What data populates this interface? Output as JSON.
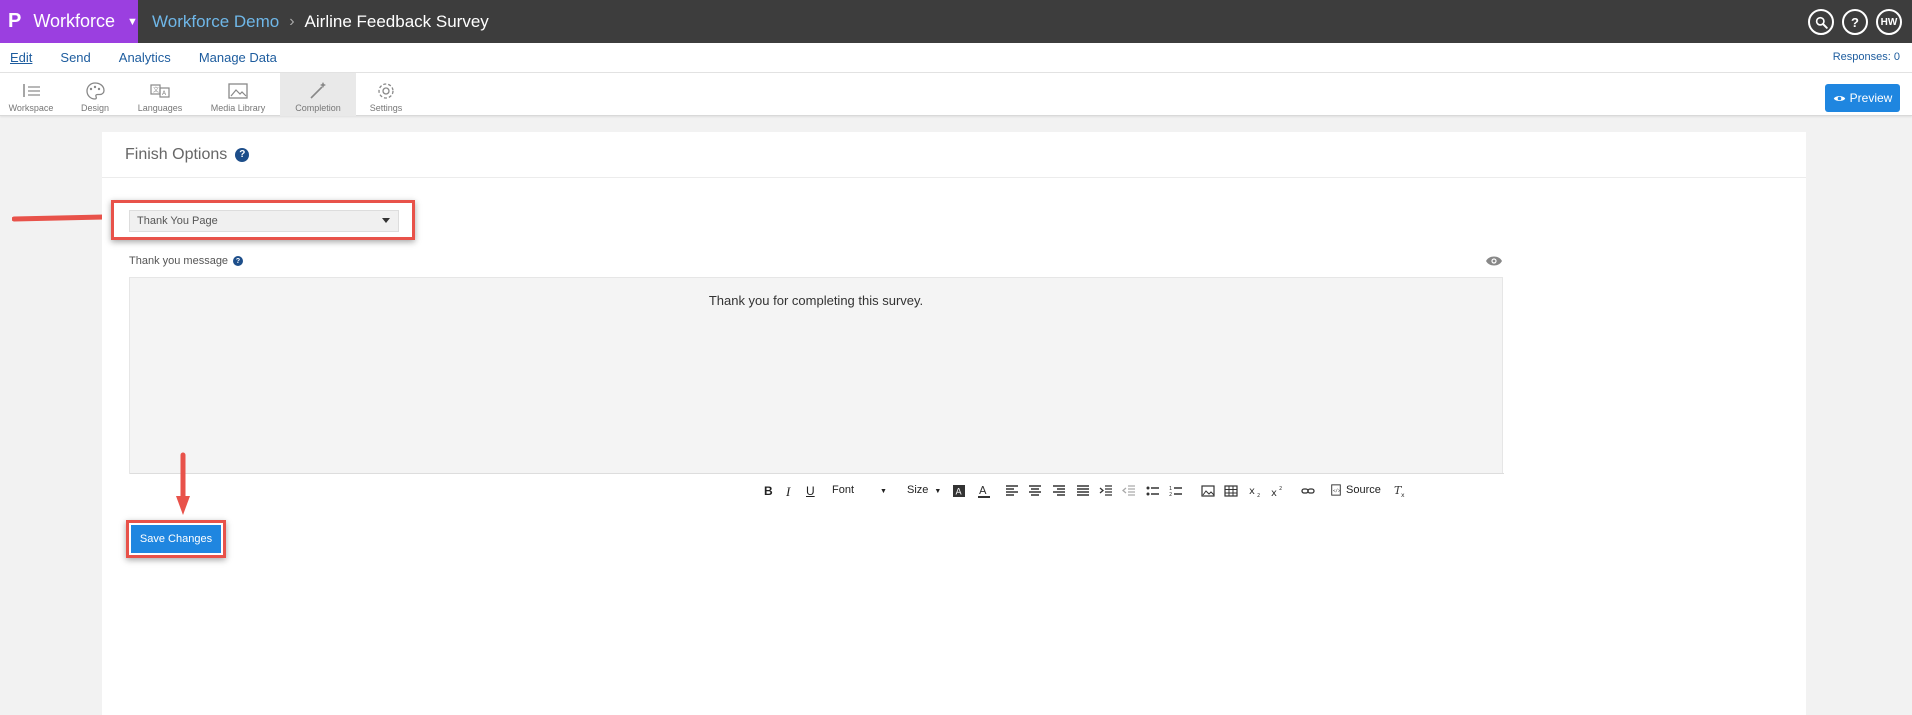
{
  "topbar": {
    "brand_logo": "P",
    "brand_name": "Workforce",
    "breadcrumb_link": "Workforce Demo",
    "breadcrumb_sep": "›",
    "breadcrumb_current": "Airline Feedback Survey",
    "user_initials": "HW",
    "help_label": "?"
  },
  "menu": {
    "items": [
      "Edit",
      "Send",
      "Analytics",
      "Manage Data"
    ],
    "responses": "Responses: 0"
  },
  "tools": {
    "items": [
      "Workspace",
      "Design",
      "Languages",
      "Media Library",
      "Completion",
      "Settings"
    ],
    "active": "Completion",
    "preview_label": "Preview"
  },
  "panel": {
    "title": "Finish Options",
    "help": "?",
    "finish_option_selected": "Thank You Page",
    "message_label": "Thank you message",
    "message_text": "Thank you for completing this survey.",
    "save_label": "Save Changes"
  },
  "editor_toolbar": {
    "bold": "B",
    "italic": "I",
    "underline": "U",
    "font_label": "Font",
    "size_label": "Size",
    "source_label": "Source"
  },
  "colors": {
    "brand_purple": "#9b3fe0",
    "topbar_dark": "#3d3d3d",
    "primary_blue": "#1f86e0",
    "annotation_red": "#e8524a"
  }
}
